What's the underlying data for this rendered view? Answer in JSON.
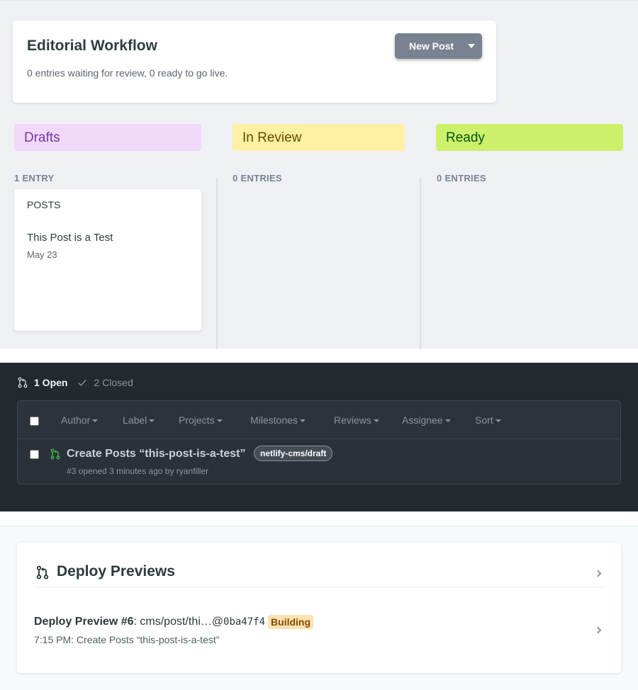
{
  "workflow": {
    "title": "Editorial Workflow",
    "subtitle": "0 entries waiting for review, 0 ready to go live.",
    "new_post_label": "New Post",
    "columns": [
      {
        "label": "Drafts",
        "count": "1 ENTRY",
        "color": "#f2d8fb"
      },
      {
        "label": "In Review",
        "count": "0 ENTRIES",
        "color": "#fff0a3"
      },
      {
        "label": "Ready",
        "count": "0 ENTRIES",
        "color": "#ccf06a"
      }
    ],
    "entry": {
      "collection": "POSTS",
      "title": "This Post is a Test",
      "date": "May 23"
    }
  },
  "github": {
    "open_label": "1 Open",
    "closed_label": "2 Closed",
    "filters": [
      "Author",
      "Label",
      "Projects",
      "Milestones",
      "Reviews",
      "Assignee",
      "Sort"
    ],
    "pr": {
      "title": "Create Posts “this-post-is-a-test”",
      "label": "netlify-cms/draft",
      "meta": "#3 opened 3 minutes ago by ryanfiller"
    }
  },
  "deploy": {
    "title": "Deploy Previews",
    "item_name": "Deploy Preview #6",
    "item_branch": ": cms/post/thi…@",
    "item_sha": "0ba47f4",
    "status": "Building",
    "subtitle": "7:15 PM: Create Posts “this-post-is-a-test”"
  },
  "icons": [
    "pull-request-icon",
    "check-icon",
    "chevron-down-icon",
    "chevron-right-icon"
  ]
}
